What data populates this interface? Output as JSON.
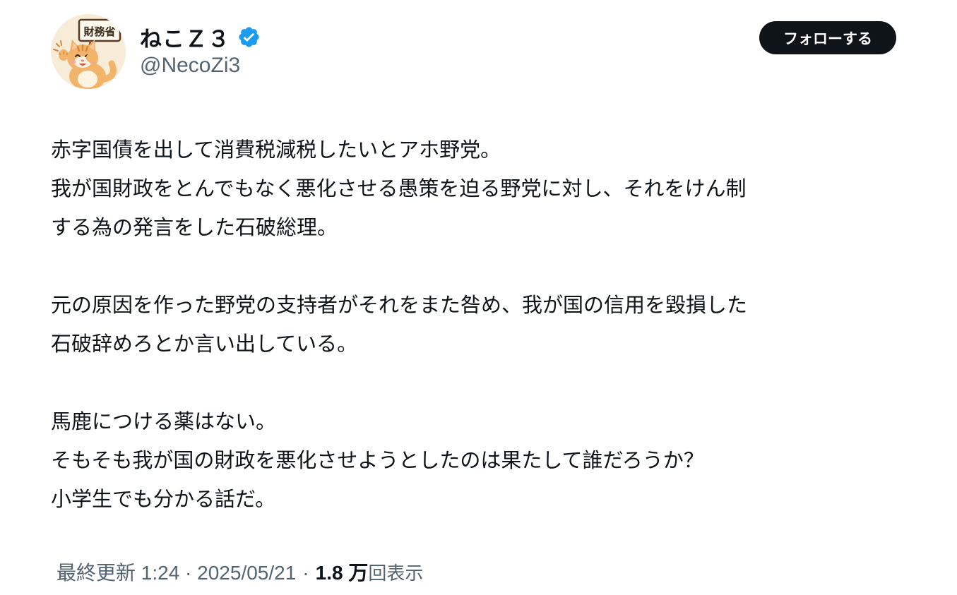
{
  "author": {
    "name": "ねこＺ３",
    "handle": "@NecoZi3",
    "avatar_sign": "財務省",
    "verified_icon": "verified-badge-icon"
  },
  "follow_button": {
    "label": "フォローする"
  },
  "tweet": {
    "paragraphs": [
      [
        "赤字国債を出して消費税減税したいとアホ野党。",
        "我が国財政をとんでもなく悪化させる愚策を迫る野党に対し、それをけん制",
        "する為の発言をした石破総理。"
      ],
      [
        "元の原因を作った野党の支持者がそれをまた咎め、我が国の信用を毀損した",
        "石破辞めろとか言い出している。"
      ],
      [
        "馬鹿につける薬はない。",
        "そもそも我が国の財政を悪化させようとしたのは果たして誰だろうか？",
        "小学生でも分かる話だ。"
      ]
    ]
  },
  "meta": {
    "timestamp": "最終更新 1:24 · 2025/05/21",
    "separator": "·",
    "views_count": "1.8 万",
    "views_label": "回表示"
  },
  "colors": {
    "text": "#0f1419",
    "secondary": "#536471",
    "verified": "#1d9bf0",
    "button_bg": "#0f1419"
  }
}
